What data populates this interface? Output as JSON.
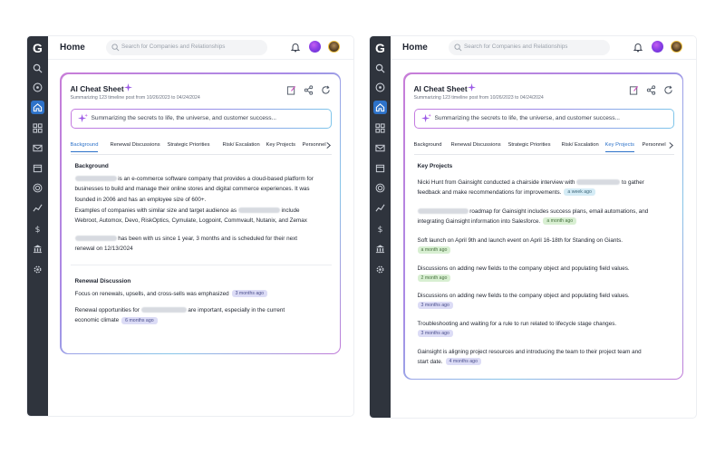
{
  "header": {
    "title": "Home",
    "search_placeholder": "Search for Companies and Relationships"
  },
  "app_logo": "G",
  "card": {
    "title": "AI Cheat Sheet",
    "subtitle": "Summarizing 123 timeline post from 10/26/2023 to 04/24/2024",
    "prompt_text": "Summarizing the secrets to life, the universe, and customer success..."
  },
  "tabs": [
    "Background",
    "Renewal Discussions",
    "Strategic Priorities",
    "Risk/ Escalation",
    "Key Projects",
    "Personnel"
  ],
  "left_panel": {
    "active_tab": "Background",
    "background": {
      "heading": "Background",
      "lines": [
        "is an e-commerce software company that provides a cloud-based platform for",
        "businesses to build and manage their online stores and digital commerce experiences. It was",
        "founded in 2006 and has an employee size of 600+.",
        "Examples of companies with similar size and target audience as",
        "include",
        "Webroot, Automox, Devo, RiskOptics, Cymulate, Logpoint, Commvault, Nutanix, and Zemax"
      ],
      "tenure_line_1": "has been with us since 1 year, 3 months and is scheduled for their next",
      "tenure_line_2": "renewal on 12/13/2024"
    },
    "renewal": {
      "heading": "Renewal Discussion",
      "item1_text": "Focus on renewals, upsells, and cross-sells was emphasized",
      "item1_time": "3 months ago",
      "item2_prefix": "Renewal opportunities for",
      "item2_suffix": "are important, especially in the current",
      "item2_line2": "economic climate",
      "item2_time": "6 months ago"
    }
  },
  "right_panel": {
    "active_tab": "Key Projects",
    "heading": "Key Projects",
    "items": [
      {
        "line1": "Nicki Hunt from Gainsight conducted a chairside interview with",
        "line1_end": "to gather",
        "line2": "feedback and make recommendations for improvements.",
        "time": "a week ago",
        "tone": "blue"
      },
      {
        "line1": "roadmap for Gainsight includes success plans, email automations, and",
        "line2": "integrating Gainsight information into Salesforce.",
        "time": "a month ago",
        "tone": "green"
      },
      {
        "line1": "Soft launch on April 9th and launch event on April 16-18th for Standing on Giants.",
        "time": "a month ago",
        "tone": "green"
      },
      {
        "line1": "Discussions on adding new fields to the company object and populating field values.",
        "time": "2 month ago",
        "tone": "green"
      },
      {
        "line1": "Discussions on adding new fields to the company object and populating field values.",
        "time": "3 months ago",
        "tone": "purple"
      },
      {
        "line1": "Troubleshooting and waiting for a rule to run related to lifecycle stage changes.",
        "time": "3 months ago",
        "tone": "purple"
      },
      {
        "line1": "Gainsight is aligning project resources and introducing the team to their project team and",
        "line2": "start date.",
        "time": "4 months ago",
        "tone": "purple"
      }
    ]
  },
  "icons": {
    "rail": [
      "search-icon",
      "compass-icon",
      "home-icon",
      "grid-icon",
      "mail-icon",
      "calendar-icon",
      "target-icon",
      "chart-icon",
      "dollar-icon",
      "bank-icon",
      "settings-icon"
    ],
    "card_actions": [
      "edit-note-icon",
      "share-icon",
      "refresh-icon"
    ]
  },
  "colors": {
    "rail_bg": "#2f343d",
    "accent": "#2d72c9",
    "card_gradient_start": "#c87dd8",
    "card_gradient_end": "#86c5e8"
  }
}
